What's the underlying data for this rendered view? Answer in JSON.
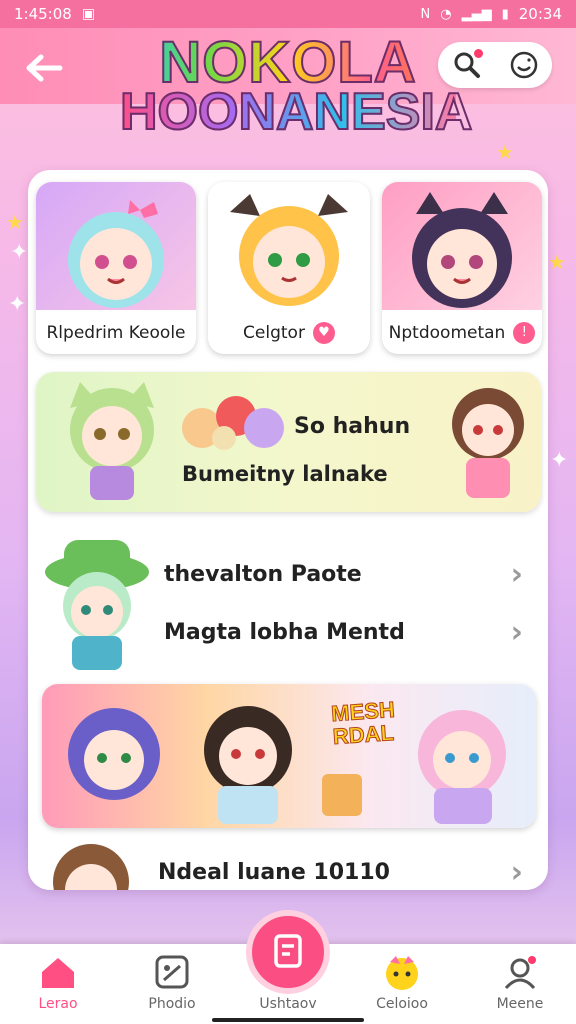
{
  "status_bar": {
    "left": "1:45:08",
    "right": "20:34"
  },
  "header": {
    "logo_line1": "NOKOLA",
    "logo_line2": "HOONANESIA"
  },
  "cards": [
    {
      "label": "Rlpedrim Keoole"
    },
    {
      "label": "Celgtor"
    },
    {
      "label": "Nptdoometan"
    }
  ],
  "banner": {
    "title": "So hahun",
    "subtitle": "Bumeitny lalnake"
  },
  "rows": [
    {
      "label": "thevalton Paote"
    },
    {
      "label": "Magta lobha Mentd"
    }
  ],
  "promo": {
    "badge_line1": "MESH",
    "badge_line2": "RDAL"
  },
  "last_row": {
    "label": "Ndeal luane 10110"
  },
  "nav": [
    {
      "label": "Lerao",
      "icon": "home-icon"
    },
    {
      "label": "Phodio",
      "icon": "gallery-icon"
    },
    {
      "label": "Ushtaov",
      "icon": "create-icon"
    },
    {
      "label": "Celoioo",
      "icon": "character-icon"
    },
    {
      "label": "Meene",
      "icon": "profile-icon"
    }
  ],
  "colors": {
    "accent": "#fb4f83",
    "header": "#ff8db5",
    "status": "#f56f9f"
  }
}
